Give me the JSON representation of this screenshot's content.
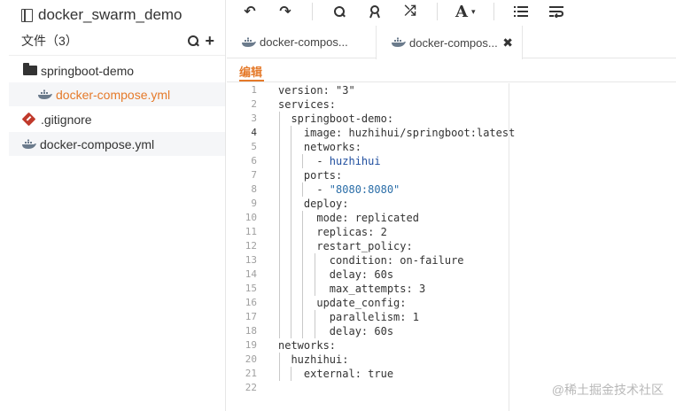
{
  "project": {
    "title": "docker_swarm_demo"
  },
  "files_header": {
    "label": "文件（3）"
  },
  "tree": [
    {
      "label": "springboot-demo",
      "icon": "folder-open-icon"
    },
    {
      "label": "docker-compose.yml",
      "icon": "docker-whale-icon"
    },
    {
      "label": ".gitignore",
      "icon": "git-icon"
    },
    {
      "label": "docker-compose.yml",
      "icon": "docker-whale-icon"
    }
  ],
  "toolbar": {
    "undo": "↶",
    "redo": "↷",
    "search": "search-icon",
    "replace": "replace-icon",
    "shuffle": "⤮",
    "font": "A",
    "font_caret": "▾",
    "list": "list-icon",
    "wrap": "wrap-icon"
  },
  "tabs": [
    {
      "label": "docker-compos..."
    },
    {
      "label": "docker-compos...",
      "close": "✖"
    }
  ],
  "subtab": {
    "label": "编辑"
  },
  "accent": "#e57a2a",
  "code": {
    "current_line": 4,
    "lines": [
      "version: \"3\"",
      "services:",
      "  springboot-demo:",
      "    image: huzhihui/springboot:latest",
      "    networks:",
      "      - huzhihui",
      "    ports:",
      "      - \"8080:8080\"",
      "    deploy:",
      "      mode: replicated",
      "      replicas: 2",
      "      restart_policy:",
      "        condition: on-failure",
      "        delay: 60s",
      "        max_attempts: 3",
      "      update_config:",
      "        parallelism: 1",
      "        delay: 60s",
      "networks:",
      "  huzhihui:",
      "    external: true",
      ""
    ]
  },
  "watermark": "@稀土掘金技术社区"
}
